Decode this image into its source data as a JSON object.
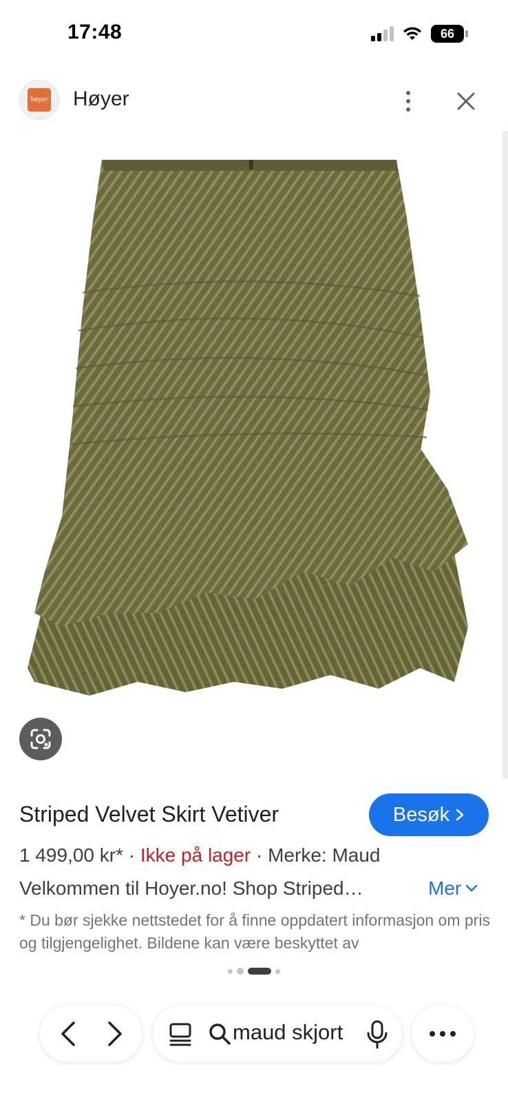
{
  "status_bar": {
    "time": "17:48",
    "battery": "66",
    "icons": [
      "cellular-signal-icon",
      "wifi-icon",
      "battery-icon"
    ]
  },
  "header": {
    "logo_text": "høyer",
    "site_name": "Høyer",
    "icons": [
      "more-vert-icon",
      "close-icon"
    ]
  },
  "image": {
    "subject": "olive striped velvet ruffle mini skirt",
    "lens_icon": "google-lens-icon"
  },
  "product": {
    "title": "Striped Velvet Skirt Vetiver",
    "visit_label": "Besøk",
    "price": "1 499,00 kr*",
    "separator": " · ",
    "stock": "Ikke på lager",
    "brand": "Merke: Maud",
    "description": "Velkommen til Hoyer.no! Shop Striped…",
    "more_label": "Mer",
    "disclaimer": "* Du bør sjekke nettstedet for å finne oppdatert informasjon om pris og tilgjengelighet. Bildene kan være beskyttet av"
  },
  "pager": {
    "count": 4,
    "active_index": 2
  },
  "bottom_bar": {
    "search_query": "maud skjort",
    "icons": [
      "back-arrow-icon",
      "forward-arrow-icon",
      "tabs-icon",
      "search-icon",
      "mic-icon",
      "more-horiz-icon"
    ]
  },
  "colors": {
    "accent": "#1a73e8",
    "stock_out": "#c5221f",
    "skirt_base": "#6b6b3f",
    "brand_orange": "#e2703a"
  }
}
